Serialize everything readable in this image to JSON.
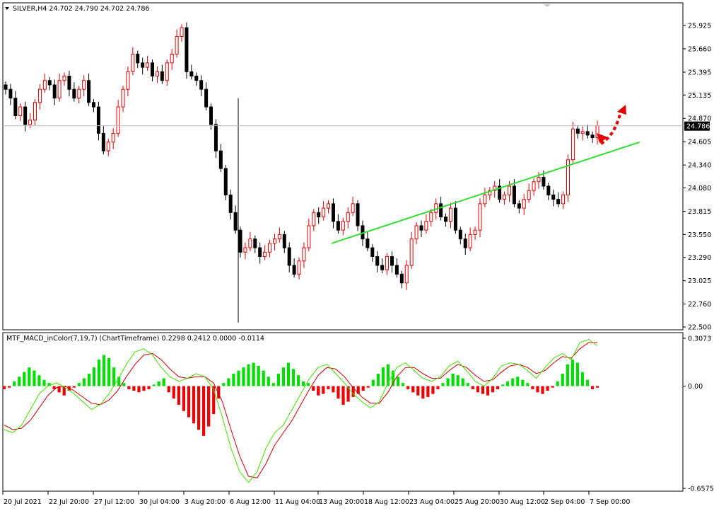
{
  "chart_data": [
    {
      "type": "candlestick",
      "symbol_header": "SILVER,H4  24.702 24.790 24.702 24.786",
      "last_price_label": "24.786",
      "last_price": 24.786,
      "ylim": [
        22.5,
        26.12
      ],
      "y_ticks": [
        "25.925",
        "25.660",
        "25.395",
        "25.135",
        "24.870",
        "24.605",
        "24.340",
        "24.080",
        "23.815",
        "23.550",
        "23.290",
        "23.025",
        "22.760",
        "22.500"
      ],
      "x_ticks": [
        "20 Jul 2021",
        "22 Jul 20:00",
        "27 Jul 12:00",
        "30 Jul 04:00",
        "3 Aug 20:00",
        "6 Aug 12:00",
        "11 Aug 04:00",
        "13 Aug 20:00",
        "18 Aug 12:00",
        "23 Aug 04:00",
        "25 Aug 20:00",
        "30 Aug 12:00",
        "2 Sep 04:00",
        "7 Sep 00:00"
      ],
      "close_path": [
        25.2,
        25.1,
        24.9,
        25.0,
        24.8,
        24.85,
        25.05,
        25.2,
        25.3,
        25.25,
        25.1,
        25.3,
        25.35,
        25.2,
        25.1,
        25.2,
        25.3,
        25.05,
        25.0,
        24.7,
        24.5,
        24.6,
        24.7,
        25.0,
        25.2,
        25.4,
        25.6,
        25.5,
        25.45,
        25.5,
        25.35,
        25.4,
        25.3,
        25.5,
        25.6,
        25.8,
        25.9,
        25.4,
        25.35,
        25.3,
        25.2,
        25.0,
        24.8,
        24.5,
        24.3,
        24.0,
        23.8,
        23.6,
        23.35,
        23.4,
        23.5,
        23.4,
        23.3,
        23.35,
        23.45,
        23.5,
        23.55,
        23.4,
        23.2,
        23.1,
        23.25,
        23.4,
        23.65,
        23.8,
        23.75,
        23.85,
        23.9,
        23.7,
        23.6,
        23.7,
        23.8,
        23.9,
        23.65,
        23.5,
        23.4,
        23.3,
        23.2,
        23.15,
        23.3,
        23.2,
        23.1,
        23.0,
        23.2,
        23.5,
        23.65,
        23.6,
        23.7,
        23.8,
        23.9,
        23.75,
        23.7,
        23.85,
        23.6,
        23.5,
        23.4,
        23.55,
        23.6,
        23.9,
        24.0,
        24.05,
        24.1,
        23.95,
        24.0,
        24.1,
        23.9,
        23.85,
        23.95,
        24.05,
        24.15,
        24.2,
        24.1,
        24.0,
        23.95,
        23.9,
        24.0,
        24.4,
        24.75,
        24.7,
        24.72,
        24.68,
        24.65,
        24.786
      ],
      "trendline": {
        "x": [
          "13 Aug 20:00",
          "7 Sep 00:00"
        ],
        "y": [
          23.45,
          24.6
        ]
      },
      "annotation": "dotted red arrow pointing up-right from trendline"
    },
    {
      "type": "bar+line",
      "title": "MTF_MACD_inColor(7,19,7) (ChartTimeframe) 0.2298 0.2412 0.0000 -0.0114",
      "ylim": [
        -0.6575,
        0.3073
      ],
      "y_ticks": [
        "0.3073",
        "0.00",
        "-0.6575"
      ],
      "histogram": [
        -0.02,
        -0.01,
        0.03,
        0.06,
        0.09,
        0.12,
        0.1,
        0.07,
        0.04,
        0.02,
        -0.02,
        -0.04,
        -0.06,
        -0.03,
        -0.01,
        0.02,
        0.05,
        0.08,
        0.12,
        0.17,
        0.2,
        0.18,
        0.12,
        0.06,
        0.02,
        -0.02,
        -0.03,
        -0.04,
        -0.03,
        -0.02,
        0.01,
        0.03,
        0.05,
        -0.04,
        -0.08,
        -0.12,
        -0.16,
        -0.2,
        -0.24,
        -0.28,
        -0.32,
        -0.26,
        -0.18,
        -0.08,
        0.02,
        0.05,
        0.08,
        0.1,
        0.12,
        0.14,
        0.15,
        0.13,
        0.1,
        0.06,
        0.02,
        0.08,
        0.12,
        0.15,
        0.11,
        0.07,
        0.03,
        0.02,
        -0.03,
        -0.06,
        -0.05,
        -0.02,
        -0.04,
        -0.08,
        -0.12,
        -0.1,
        -0.07,
        -0.05,
        -0.03,
        -0.01,
        0.04,
        0.08,
        0.12,
        0.14,
        0.1,
        0.06,
        0.02,
        -0.02,
        -0.04,
        -0.06,
        -0.08,
        -0.07,
        -0.05,
        -0.02,
        0.02,
        0.05,
        0.08,
        0.07,
        0.05,
        0.02,
        -0.02,
        -0.04,
        -0.05,
        -0.06,
        -0.04,
        -0.02,
        0.01,
        0.03,
        0.05,
        0.06,
        0.04,
        0.02,
        -0.02,
        -0.04,
        -0.05,
        -0.03,
        -0.01,
        0.03,
        0.08,
        0.14,
        0.17,
        0.15,
        0.09,
        0.04,
        -0.02,
        -0.01
      ],
      "macd_path": [
        -0.28,
        -0.3,
        -0.25,
        -0.15,
        -0.05,
        0.0,
        0.02,
        -0.01,
        -0.05,
        -0.1,
        -0.15,
        -0.12,
        -0.05,
        0.04,
        0.14,
        0.22,
        0.24,
        0.2,
        0.12,
        0.06,
        0.03,
        0.05,
        0.08,
        0.06,
        -0.02,
        -0.2,
        -0.4,
        -0.55,
        -0.62,
        -0.55,
        -0.4,
        -0.3,
        -0.25,
        -0.15,
        -0.05,
        0.05,
        0.12,
        0.14,
        0.08,
        0.02,
        -0.05,
        -0.1,
        -0.14,
        -0.1,
        0.02,
        0.12,
        0.15,
        0.1,
        0.05,
        0.03,
        0.06,
        0.13,
        0.16,
        0.1,
        0.03,
        0.0,
        0.05,
        0.13,
        0.15,
        0.14,
        0.1,
        0.05,
        0.12,
        0.18,
        0.21,
        0.17,
        0.28,
        0.3,
        0.26
      ],
      "signal_path": [
        -0.25,
        -0.28,
        -0.27,
        -0.22,
        -0.14,
        -0.06,
        -0.01,
        0.0,
        -0.03,
        -0.07,
        -0.11,
        -0.12,
        -0.09,
        -0.03,
        0.06,
        0.14,
        0.2,
        0.21,
        0.17,
        0.11,
        0.06,
        0.05,
        0.06,
        0.06,
        0.02,
        -0.1,
        -0.28,
        -0.45,
        -0.58,
        -0.59,
        -0.5,
        -0.38,
        -0.3,
        -0.22,
        -0.12,
        -0.02,
        0.07,
        0.12,
        0.11,
        0.06,
        -0.01,
        -0.07,
        -0.11,
        -0.11,
        -0.04,
        0.06,
        0.12,
        0.12,
        0.08,
        0.05,
        0.05,
        0.1,
        0.14,
        0.12,
        0.07,
        0.03,
        0.04,
        0.09,
        0.13,
        0.14,
        0.12,
        0.08,
        0.1,
        0.15,
        0.19,
        0.18,
        0.24,
        0.28,
        0.28
      ]
    }
  ],
  "colors": {
    "bull": "#e00000",
    "bear": "#000000",
    "hist_pos": "#00dd00",
    "hist_neg": "#ee0000",
    "macd_line": "#44dd00",
    "signal_line": "#cc0000",
    "trendline": "#33dd33"
  }
}
